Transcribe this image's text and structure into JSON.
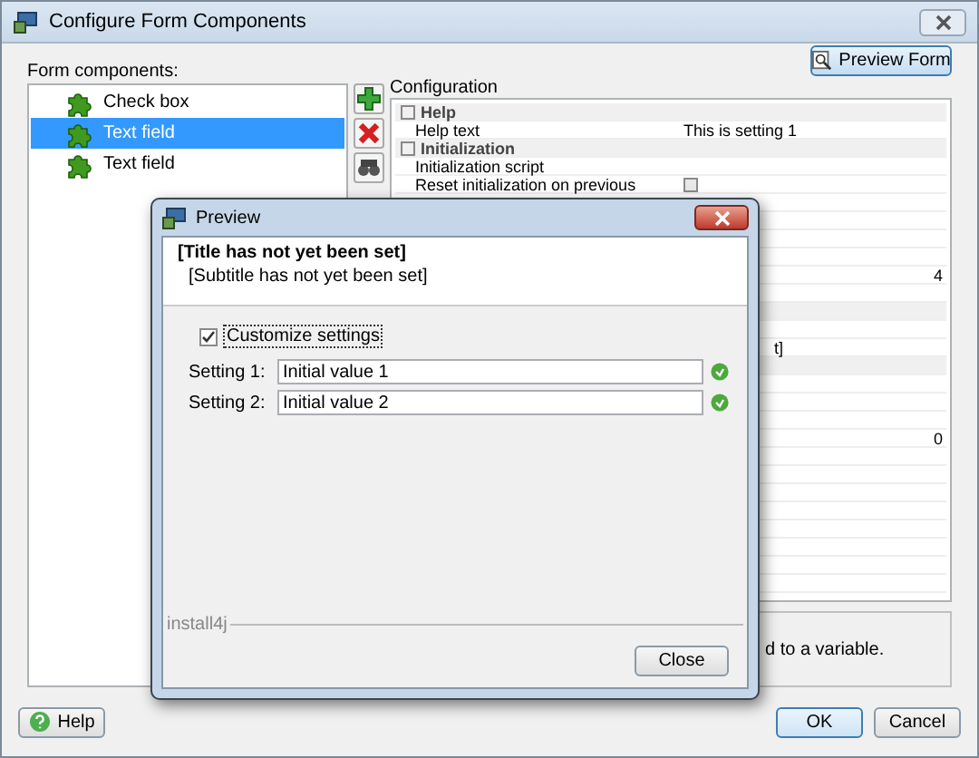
{
  "window": {
    "title": "Configure Form Components"
  },
  "preview_button": "Preview Form",
  "components_label": "Form components:",
  "components": [
    {
      "label": "Check box",
      "selected": false
    },
    {
      "label": "Text field",
      "selected": true
    },
    {
      "label": "Text field",
      "selected": false
    }
  ],
  "configuration": {
    "title": "Configuration",
    "rows": [
      {
        "kind": "group",
        "label": "Help"
      },
      {
        "kind": "property",
        "label": "Help text",
        "value": "This is setting 1"
      },
      {
        "kind": "group",
        "label": "Initialization"
      },
      {
        "kind": "property",
        "label": "Initialization script"
      },
      {
        "kind": "checkbox",
        "label": "Reset initialization on previous",
        "checked": false
      },
      {
        "kind": "property"
      },
      {
        "kind": "property"
      },
      {
        "kind": "property"
      },
      {
        "kind": "property"
      },
      {
        "kind": "number",
        "value": "4"
      },
      {
        "kind": "property"
      },
      {
        "kind": "group"
      },
      {
        "kind": "property"
      },
      {
        "kind": "cut",
        "value": "t]"
      },
      {
        "kind": "group"
      },
      {
        "kind": "property"
      },
      {
        "kind": "property"
      },
      {
        "kind": "property"
      },
      {
        "kind": "number",
        "value": "0"
      },
      {
        "kind": "property"
      },
      {
        "kind": "property"
      },
      {
        "kind": "property"
      },
      {
        "kind": "property"
      },
      {
        "kind": "property"
      },
      {
        "kind": "property"
      },
      {
        "kind": "property"
      },
      {
        "kind": "property"
      }
    ],
    "description": "d to a variable."
  },
  "buttons": {
    "help": "Help",
    "ok": "OK",
    "cancel": "Cancel"
  },
  "preview": {
    "title": "Preview",
    "heading": "[Title has not yet been set]",
    "subtitle": "[Subtitle has not yet been set]",
    "customize": {
      "label": "Customize settings",
      "checked": true
    },
    "settings": [
      {
        "label": "Setting 1:",
        "value": "Initial value 1"
      },
      {
        "label": "Setting 2:",
        "value": "Initial value 2"
      }
    ],
    "brand": "install4j",
    "close": "Close"
  }
}
